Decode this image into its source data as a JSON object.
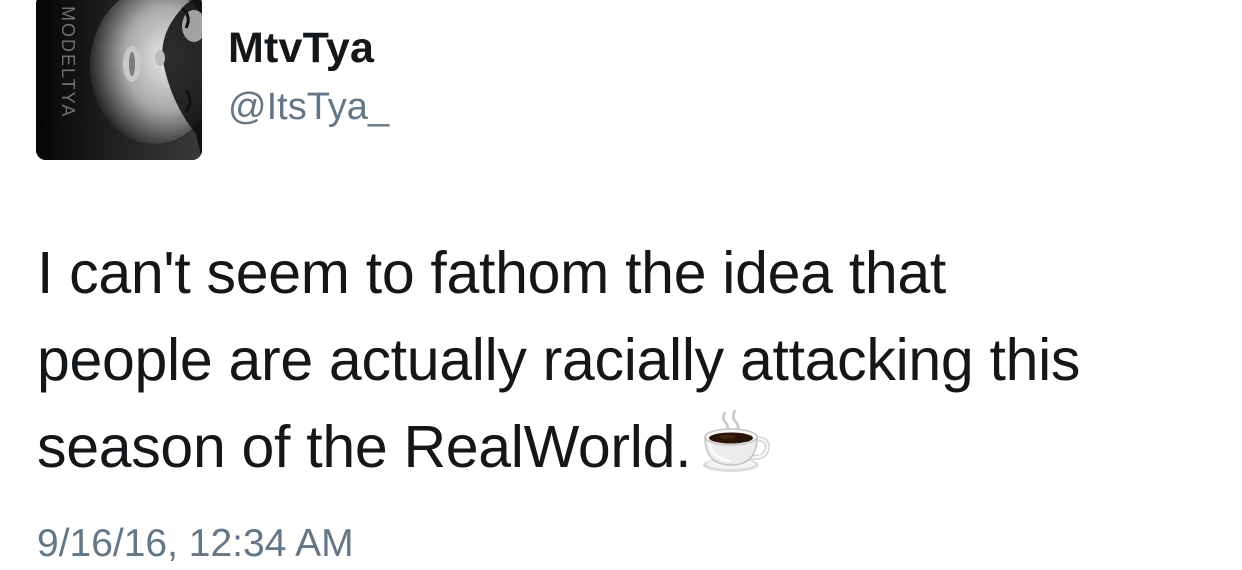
{
  "user": {
    "display_name": "MtvTya",
    "handle": "@ItsTya_",
    "avatar_watermark": "MODELTYA"
  },
  "tweet": {
    "lines": [
      "I can't seem to fathom the idea that",
      "people are actually racially attacking this",
      "season of the RealWorld."
    ],
    "emoji": "coffee-icon",
    "timestamp": "9/16/16, 12:34 AM"
  },
  "colors": {
    "primary_text": "#14171a",
    "secondary_text": "#657786",
    "background": "#ffffff"
  }
}
